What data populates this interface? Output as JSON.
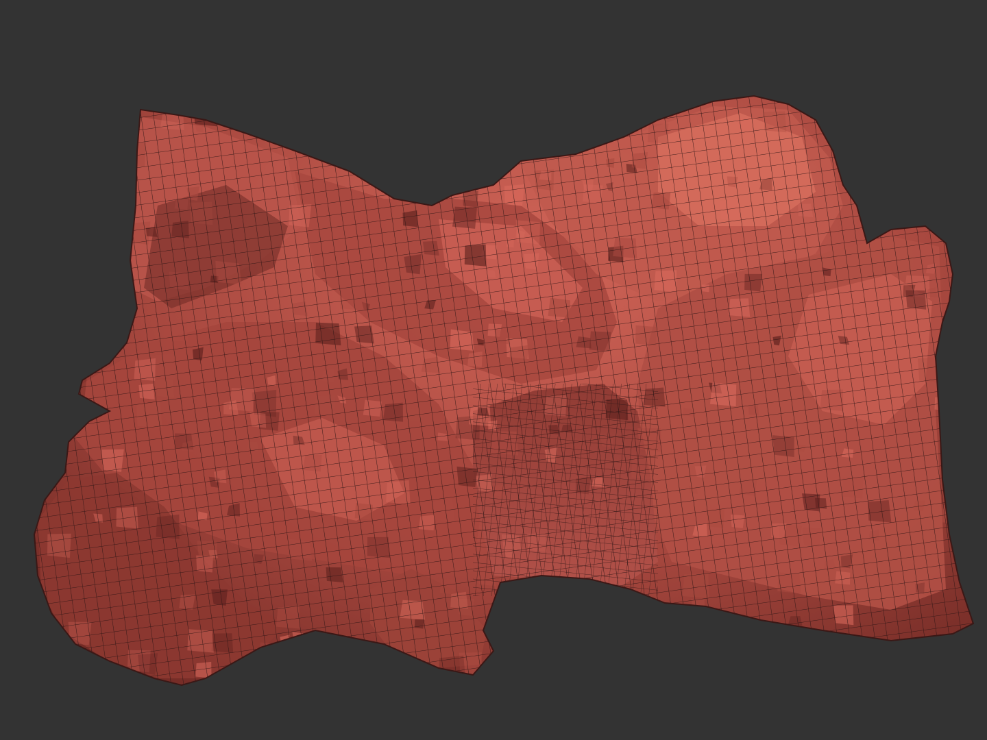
{
  "viewport": {
    "background_color": "#333333"
  },
  "terrain_mesh": {
    "base_color": "#a94a40",
    "highlight_color": "#d8695c",
    "shadow_color": "#5a1f1c",
    "wire_color": "#2a1414"
  }
}
